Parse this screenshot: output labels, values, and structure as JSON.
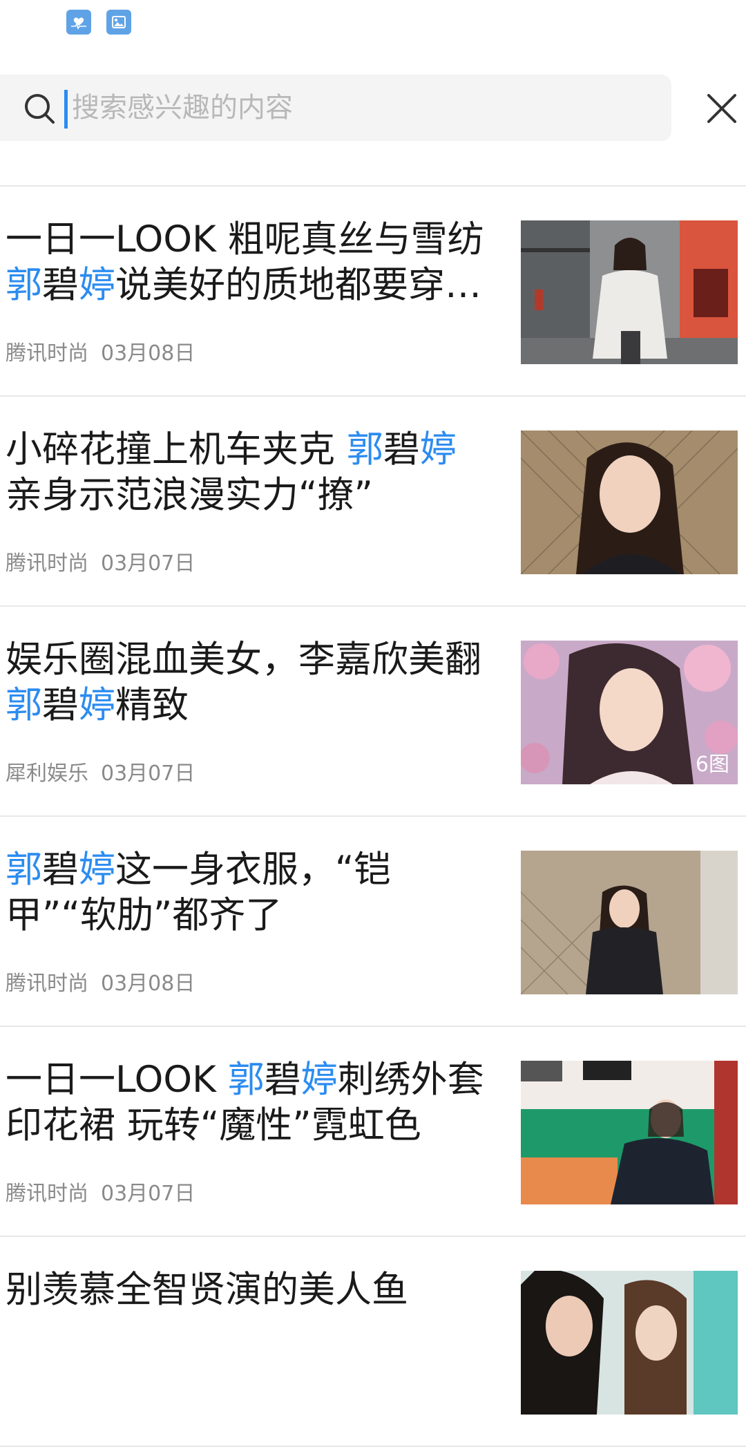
{
  "search": {
    "placeholder": "搜索感兴趣的内容"
  },
  "colors": {
    "accent": "#2c8cf0",
    "meta_text": "#8a8a8a",
    "divider": "#e8e8e8"
  },
  "news": [
    {
      "title_parts": [
        {
          "t": "一日一LOOK 粗呢真丝与雪纺",
          "hl": false
        },
        {
          "t": "郭",
          "hl": true
        },
        {
          "t": "碧",
          "hl": false
        },
        {
          "t": "婷",
          "hl": true
        },
        {
          "t": "说美好的质地都要穿…",
          "hl": false
        }
      ],
      "source": "腾讯时尚",
      "date": "03月08日",
      "thumb": "street-fashion-photo",
      "badge": ""
    },
    {
      "title_parts": [
        {
          "t": "小碎花撞上机车夹克 ",
          "hl": false
        },
        {
          "t": "郭",
          "hl": true
        },
        {
          "t": "碧",
          "hl": false
        },
        {
          "t": "婷",
          "hl": true
        },
        {
          "t": "亲身示范浪漫实力“撩”",
          "hl": false
        }
      ],
      "source": "腾讯时尚",
      "date": "03月07日",
      "thumb": "portrait-fence-photo",
      "badge": ""
    },
    {
      "title_parts": [
        {
          "t": "娱乐圈混血美女，李嘉欣美翻",
          "hl": false
        },
        {
          "t": "郭",
          "hl": true
        },
        {
          "t": "碧",
          "hl": false
        },
        {
          "t": "婷",
          "hl": true
        },
        {
          "t": "精致",
          "hl": false
        }
      ],
      "source": "犀利娱乐",
      "date": "03月07日",
      "thumb": "blossom-portrait-photo",
      "badge": "6图"
    },
    {
      "title_parts": [
        {
          "t": "郭",
          "hl": true
        },
        {
          "t": "碧",
          "hl": false
        },
        {
          "t": "婷",
          "hl": true
        },
        {
          "t": "这一身衣服，“铠甲”“软肋”都齐了",
          "hl": false
        }
      ],
      "source": "腾讯时尚",
      "date": "03月08日",
      "thumb": "fence-street-photo",
      "badge": ""
    },
    {
      "title_parts": [
        {
          "t": "一日一LOOK ",
          "hl": false
        },
        {
          "t": "郭",
          "hl": true
        },
        {
          "t": "碧",
          "hl": false
        },
        {
          "t": "婷",
          "hl": true
        },
        {
          "t": "刺绣外套印花裙 玩转“魔性”霓虹色",
          "hl": false
        }
      ],
      "source": "腾讯时尚",
      "date": "03月07日",
      "thumb": "green-room-photo",
      "badge": ""
    },
    {
      "title_parts": [
        {
          "t": "别羡慕全智贤演的美人鱼",
          "hl": false
        }
      ],
      "source": "",
      "date": "",
      "thumb": "couple-photo",
      "badge": ""
    }
  ]
}
